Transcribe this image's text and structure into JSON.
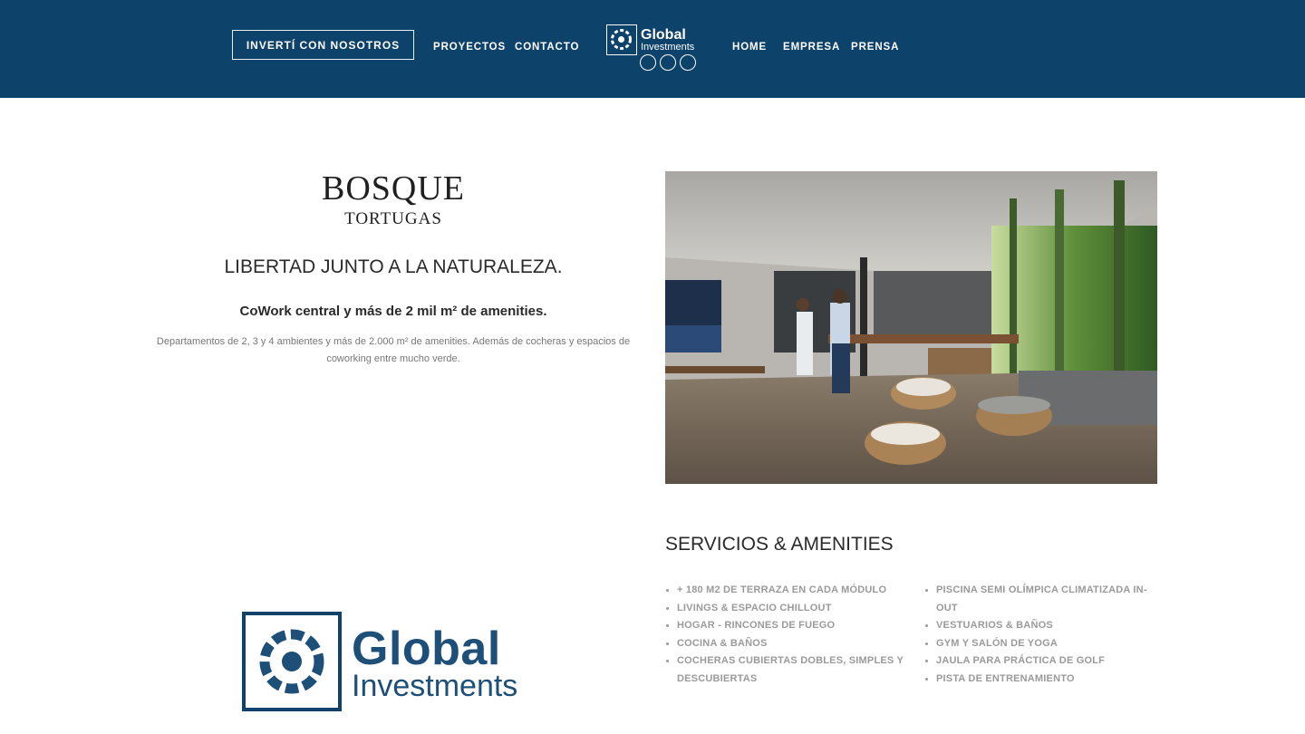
{
  "header": {
    "cta_label": "INVERTÍ CON NOSOTROS",
    "nav_left": [
      "PROYECTOS",
      "CONTACTO"
    ],
    "nav_right": [
      "HOME",
      "EMPRESA",
      "PRENSA"
    ],
    "logo_line1": "Global",
    "logo_line2": "Investments",
    "bg_color": "#0d426b"
  },
  "project": {
    "brand_name": "BOSQUE",
    "brand_sub": "TORTUGAS",
    "headline": "LIBERTAD JUNTO A LA NATURALEZA.",
    "subheadline": "CoWork central y más de 2 mil m² de amenities.",
    "description": "Departamentos de 2, 3 y 4 ambientes y más de 2.000 m² de amenities. Además de cocheras y espacios de coworking entre mucho verde."
  },
  "services": {
    "title": "SERVICIOS & AMENITIES",
    "left": [
      "+ 180 M2 DE TERRAZA EN CADA MÓDULO",
      "LIVINGS & ESPACIO CHILLOUT",
      "HOGAR - RINCONES DE FUEGO",
      "COCINA & BAÑOS",
      "COCHERAS CUBIERTAS DOBLES, SIMPLES Y DESCUBIERTAS"
    ],
    "right": [
      "PISCINA SEMI OLÍMPICA CLIMATIZADA IN-OUT",
      "VESTUARIOS & BAÑOS",
      "GYM Y SALÓN DE YOGA",
      "JAULA PARA PRÁCTICA DE GOLF",
      "PISTA DE ENTRENAMIENTO"
    ]
  },
  "footer_logo": {
    "line1": "Global",
    "line2": "Investments"
  }
}
